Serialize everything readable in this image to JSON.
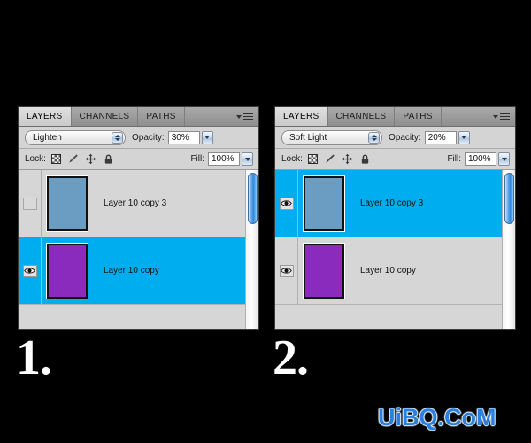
{
  "background_color": "#000000",
  "panels": [
    {
      "caption": "1.",
      "tabs": [
        {
          "label": "LAYERS",
          "active": true
        },
        {
          "label": "CHANNELS",
          "active": false
        },
        {
          "label": "PATHS",
          "active": false
        }
      ],
      "blend_mode": "Lighten",
      "opacity_label": "Opacity:",
      "opacity_value": "30%",
      "lock_label": "Lock:",
      "lock_icons": [
        "transparency-checker-icon",
        "paintbrush-icon",
        "move-arrows-icon",
        "padlock-icon"
      ],
      "fill_label": "Fill:",
      "fill_value": "100%",
      "layers": [
        {
          "name": "Layer 10 copy 3",
          "visible": false,
          "selected": false,
          "thumb_color": "#6b9dc2"
        },
        {
          "name": "Layer 10 copy",
          "visible": true,
          "selected": true,
          "thumb_color": "#8a2bbe"
        }
      ]
    },
    {
      "caption": "2.",
      "tabs": [
        {
          "label": "LAYERS",
          "active": true
        },
        {
          "label": "CHANNELS",
          "active": false
        },
        {
          "label": "PATHS",
          "active": false
        }
      ],
      "blend_mode": "Soft Light",
      "opacity_label": "Opacity:",
      "opacity_value": "20%",
      "lock_label": "Lock:",
      "lock_icons": [
        "transparency-checker-icon",
        "paintbrush-icon",
        "move-arrows-icon",
        "padlock-icon"
      ],
      "fill_label": "Fill:",
      "fill_value": "100%",
      "layers": [
        {
          "name": "Layer 10 copy 3",
          "visible": true,
          "selected": true,
          "thumb_color": "#6b9dc2"
        },
        {
          "name": "Layer 10 copy",
          "visible": true,
          "selected": false,
          "thumb_color": "#8a2bbe"
        }
      ]
    }
  ],
  "watermark": {
    "text": "UiBQ.CoM",
    "color": "#2b7fe0"
  },
  "colors": {
    "selection_blue": "#00aeef",
    "panel_background": "#d6d6d6",
    "tab_active": "#dcdcdc",
    "thumb_blue_gray": "#6b9dc2",
    "thumb_purple": "#8a2bbe"
  }
}
